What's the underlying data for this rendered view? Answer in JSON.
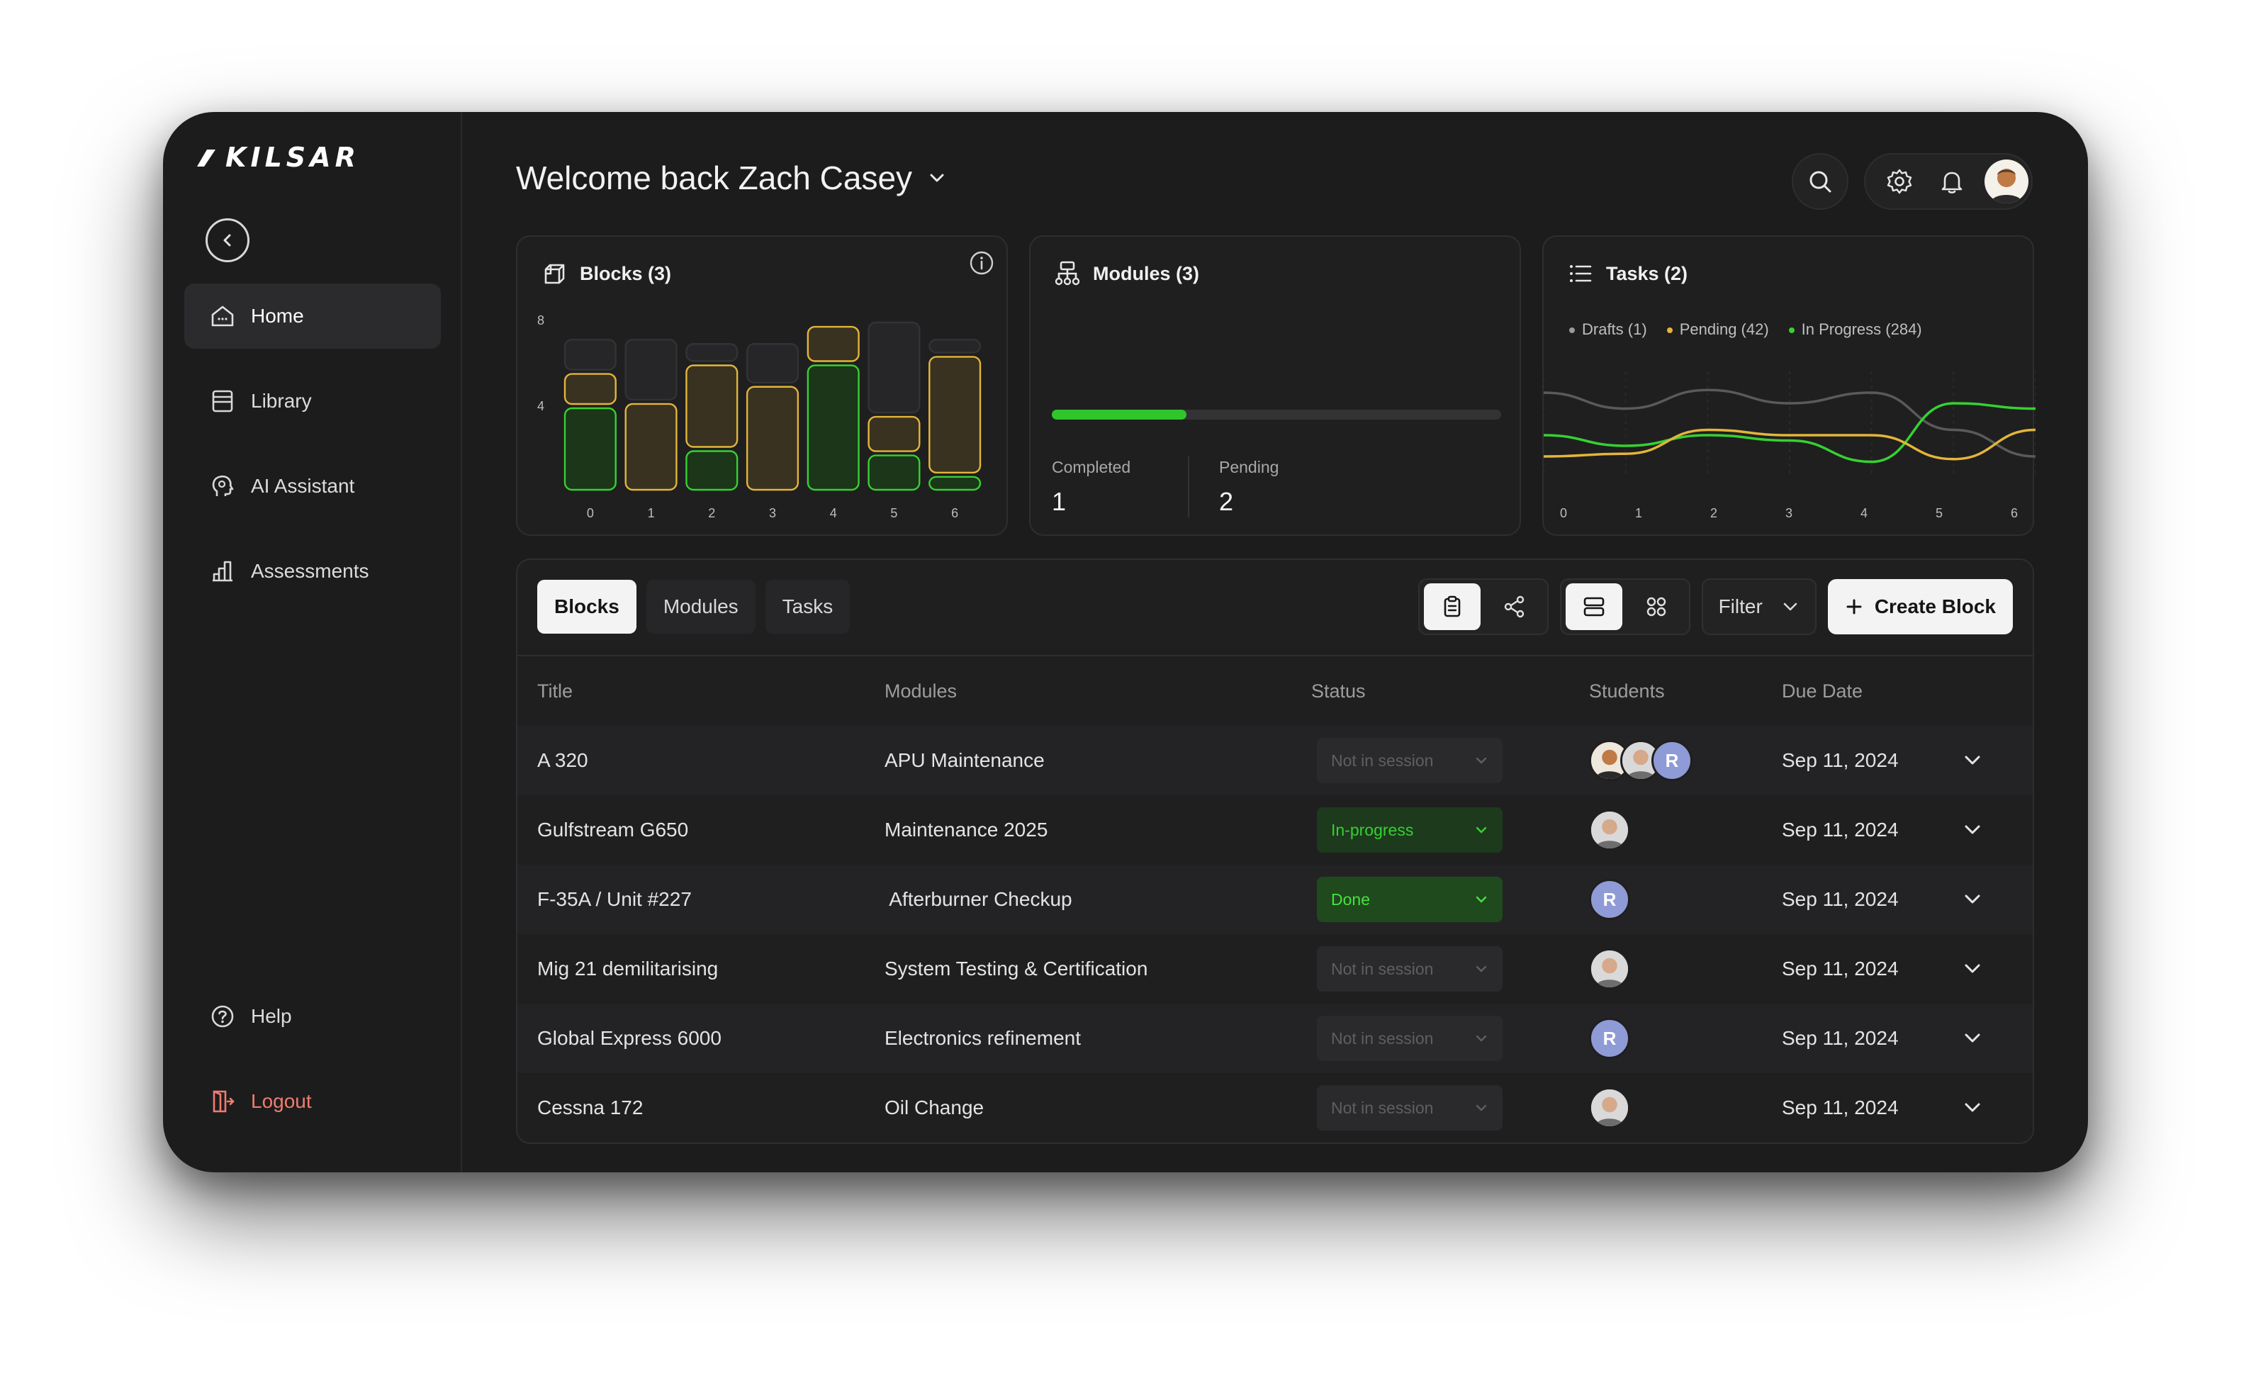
{
  "app": {
    "logo_text": "KILSAR"
  },
  "sidebar": {
    "items": [
      {
        "label": "Home",
        "icon": "home-icon",
        "active": true
      },
      {
        "label": "Library",
        "icon": "library-icon"
      },
      {
        "label": "AI Assistant",
        "icon": "ai-assistant-icon"
      },
      {
        "label": "Assessments",
        "icon": "assessments-icon"
      }
    ],
    "help_label": "Help",
    "logout_label": "Logout"
  },
  "header": {
    "title": "Welcome back Zach Casey"
  },
  "cards": {
    "blocks": {
      "title": "Blocks (3)"
    },
    "modules": {
      "title": "Modules (3)",
      "progress": 0.3,
      "completed_label": "Completed",
      "completed_value": "1",
      "pending_label": "Pending",
      "pending_value": "2"
    },
    "tasks": {
      "title": "Tasks (2)",
      "legend": [
        {
          "label": "Drafts (1)",
          "color": "#9a9a9a"
        },
        {
          "label": "Pending (42)",
          "color": "#e3b53a"
        },
        {
          "label": "In Progress (284)",
          "color": "#36d131"
        }
      ]
    }
  },
  "chart_data": [
    {
      "type": "bar",
      "stacked": true,
      "categories": [
        "0",
        "1",
        "2",
        "3",
        "4",
        "5",
        "6"
      ],
      "y_ticks": [
        "8",
        "4"
      ],
      "ylim": [
        0,
        8
      ],
      "series": [
        {
          "color": "#36d131",
          "values": [
            4.0,
            0,
            2.0,
            0,
            6.0,
            1.8,
            0.8
          ]
        },
        {
          "color": "#e3b53a",
          "values": [
            1.6,
            4.2,
            4.0,
            5.0,
            1.8,
            1.8,
            5.6
          ]
        },
        {
          "color": "#3a3a3c",
          "values": [
            1.6,
            3.0,
            1.0,
            2.0,
            0,
            4.4,
            0.8
          ]
        }
      ]
    },
    {
      "type": "line",
      "x": [
        "0",
        "1",
        "2",
        "3",
        "4",
        "5",
        "6"
      ],
      "series": [
        {
          "color": "#5a5a5c",
          "values": [
            3.2,
            2.6,
            3.3,
            2.8,
            3.2,
            1.8,
            0.8
          ]
        },
        {
          "color": "#36d131",
          "values": [
            1.6,
            1.2,
            1.6,
            1.4,
            0.6,
            2.8,
            2.6
          ]
        },
        {
          "color": "#e3b53a",
          "values": [
            0.8,
            0.9,
            1.8,
            1.6,
            1.6,
            0.7,
            1.8
          ]
        }
      ]
    }
  ],
  "table": {
    "tabs": [
      "Blocks",
      "Modules",
      "Tasks"
    ],
    "filter_label": "Filter",
    "create_label": "Create Block",
    "columns": [
      "Title",
      "Modules",
      "Status",
      "Students",
      "Due Date"
    ],
    "rows": [
      {
        "title": "A 320",
        "module": "APU Maintenance",
        "status": "Not in session",
        "date": "Sep 11, 2024"
      },
      {
        "title": "Gulfstream G650",
        "module": "Maintenance 2025",
        "status": "In-progress",
        "date": "Sep 11, 2024"
      },
      {
        "title": "F-35A / Unit #227",
        "module": " Afterburner Checkup",
        "status": "Done",
        "date": "Sep 11, 2024"
      },
      {
        "title": "Mig 21 demilitarising",
        "module": "System Testing & Certification",
        "status": "Not in session",
        "date": "Sep 11, 2024"
      },
      {
        "title": "Global Express 6000",
        "module": "Electronics refinement",
        "status": "Not in session",
        "date": "Sep 11, 2024"
      },
      {
        "title": "Cessna 172",
        "module": "Oil Change",
        "status": "Not in session",
        "date": "Sep 11, 2024"
      }
    ],
    "avatar_initial": "R"
  },
  "colors": {
    "accent_green": "#36d131",
    "accent_yellow": "#e3b53a",
    "logout_red": "#f07c6e"
  }
}
